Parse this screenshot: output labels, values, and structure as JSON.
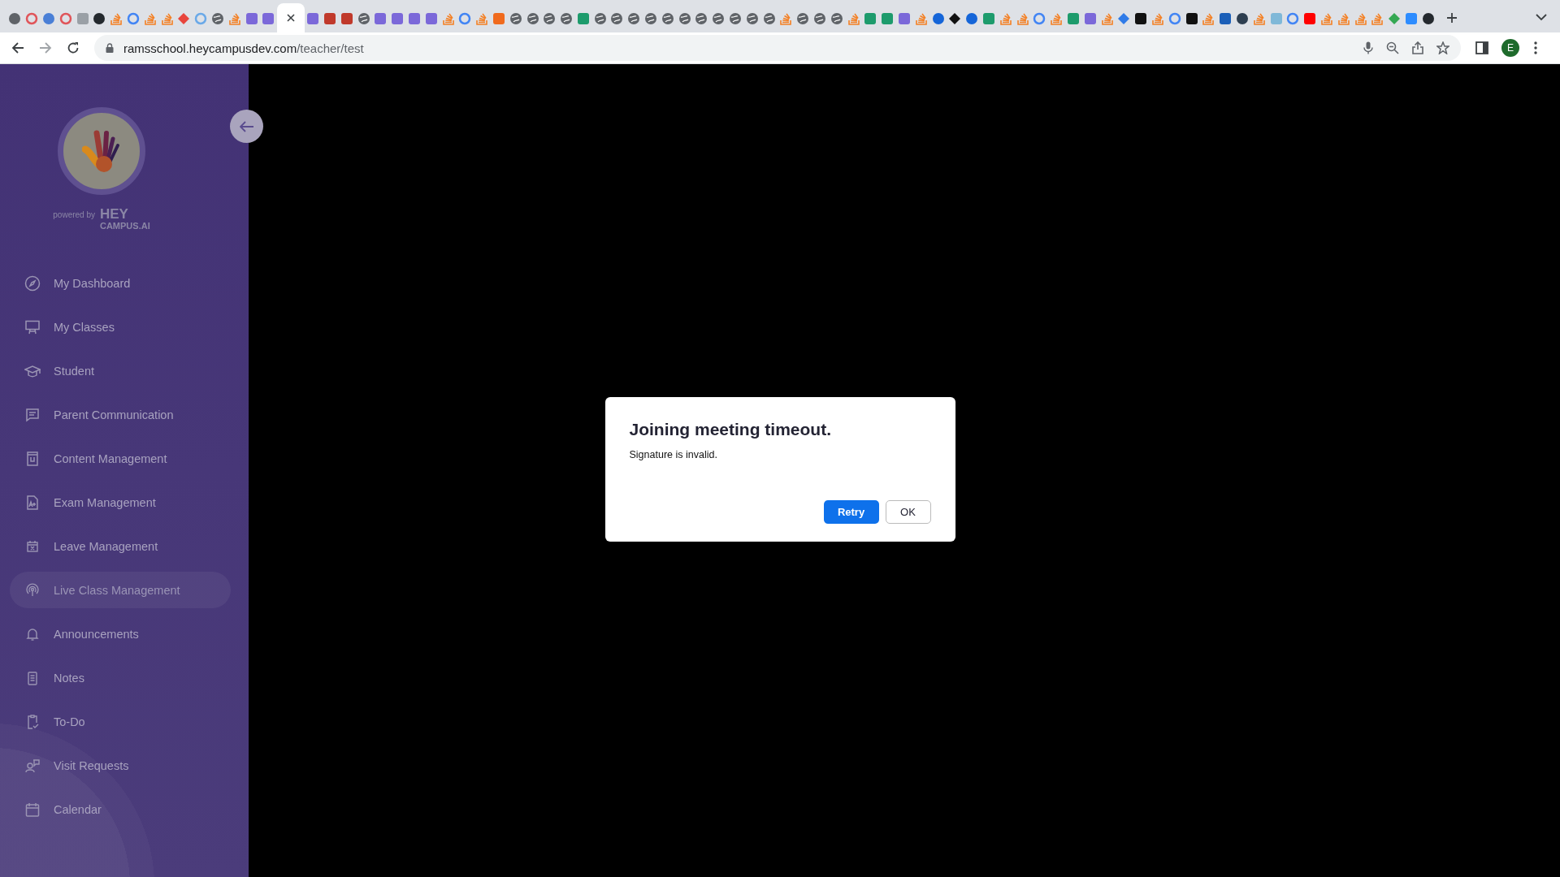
{
  "browser": {
    "tabs": [
      {
        "kind": "chrome",
        "selected": false
      },
      {
        "kind": "bug",
        "selected": false
      },
      {
        "kind": "cube",
        "selected": false
      },
      {
        "kind": "bug",
        "selected": false
      },
      {
        "kind": "star",
        "selected": false
      },
      {
        "kind": "github",
        "selected": false
      },
      {
        "kind": "stack",
        "selected": false
      },
      {
        "kind": "g",
        "selected": false
      },
      {
        "kind": "stack",
        "selected": false
      },
      {
        "kind": "stack",
        "selected": false
      },
      {
        "kind": "layers",
        "selected": false
      },
      {
        "kind": "cloud",
        "selected": false
      },
      {
        "kind": "globe",
        "selected": false
      },
      {
        "kind": "stack",
        "selected": false
      },
      {
        "kind": "h",
        "selected": false
      },
      {
        "kind": "h",
        "selected": false
      },
      {
        "selected": true
      },
      {
        "kind": "h",
        "selected": false
      },
      {
        "kind": "ghost",
        "selected": false
      },
      {
        "kind": "ghost",
        "selected": false
      },
      {
        "kind": "globe",
        "selected": false
      },
      {
        "kind": "h",
        "selected": false
      },
      {
        "kind": "h",
        "selected": false
      },
      {
        "kind": "h",
        "selected": false
      },
      {
        "kind": "h",
        "selected": false
      },
      {
        "kind": "stack",
        "selected": false
      },
      {
        "kind": "g",
        "selected": false
      },
      {
        "kind": "stack",
        "selected": false
      },
      {
        "kind": "f",
        "selected": false
      },
      {
        "kind": "globe",
        "selected": false
      },
      {
        "kind": "globe",
        "selected": false
      },
      {
        "kind": "globe",
        "selected": false
      },
      {
        "kind": "globe",
        "selected": false
      },
      {
        "kind": "w",
        "selected": false
      },
      {
        "kind": "globe",
        "selected": false
      },
      {
        "kind": "globe",
        "selected": false
      },
      {
        "kind": "globe",
        "selected": false
      },
      {
        "kind": "globe",
        "selected": false
      },
      {
        "kind": "globe",
        "selected": false
      },
      {
        "kind": "globe",
        "selected": false
      },
      {
        "kind": "globe",
        "selected": false
      },
      {
        "kind": "globe",
        "selected": false
      },
      {
        "kind": "globe",
        "selected": false
      },
      {
        "kind": "globe",
        "selected": false
      },
      {
        "kind": "globe",
        "selected": false
      },
      {
        "kind": "stack",
        "selected": false
      },
      {
        "kind": "globe",
        "selected": false
      },
      {
        "kind": "globe",
        "selected": false
      },
      {
        "kind": "globe",
        "selected": false
      },
      {
        "kind": "stack",
        "selected": false
      },
      {
        "kind": "w",
        "selected": false
      },
      {
        "kind": "w",
        "selected": false
      },
      {
        "kind": "h",
        "selected": false
      },
      {
        "kind": "stack",
        "selected": false
      },
      {
        "kind": "c",
        "selected": false
      },
      {
        "kind": "codepen",
        "selected": false
      },
      {
        "kind": "c",
        "selected": false
      },
      {
        "kind": "w",
        "selected": false
      },
      {
        "kind": "stack",
        "selected": false
      },
      {
        "kind": "stack",
        "selected": false
      },
      {
        "kind": "g",
        "selected": false
      },
      {
        "kind": "stack",
        "selected": false
      },
      {
        "kind": "w",
        "selected": false
      },
      {
        "kind": "h",
        "selected": false
      },
      {
        "kind": "stack",
        "selected": false
      },
      {
        "kind": "arrow",
        "selected": false
      },
      {
        "kind": "m",
        "selected": false
      },
      {
        "kind": "stack",
        "selected": false
      },
      {
        "kind": "g",
        "selected": false
      },
      {
        "kind": "m",
        "selected": false
      },
      {
        "kind": "stack",
        "selected": false
      },
      {
        "kind": "im",
        "selected": false
      },
      {
        "kind": "circle",
        "selected": false
      },
      {
        "kind": "stack",
        "selected": false
      },
      {
        "kind": "ib",
        "selected": false
      },
      {
        "kind": "g",
        "selected": false
      },
      {
        "kind": "youtube",
        "selected": false
      },
      {
        "kind": "stack",
        "selected": false
      },
      {
        "kind": "stack",
        "selected": false
      },
      {
        "kind": "stack",
        "selected": false
      },
      {
        "kind": "stack",
        "selected": false
      },
      {
        "kind": "maps",
        "selected": false
      },
      {
        "kind": "z",
        "selected": false
      },
      {
        "kind": "github",
        "selected": false
      }
    ],
    "address": {
      "host": "ramsschool.heycampusdev.com",
      "path": "/teacher/test"
    },
    "profile_initial": "E"
  },
  "sidebar": {
    "powered_by": "powered by",
    "brand_top": "HEY",
    "brand_bottom": "CAMPUS.AI",
    "items": [
      {
        "label": "My Dashboard",
        "kind": "dashboard",
        "selected": false
      },
      {
        "label": "My Classes",
        "kind": "board",
        "selected": false
      },
      {
        "label": "Student",
        "kind": "cap",
        "selected": false
      },
      {
        "label": "Parent Communication",
        "kind": "chat",
        "selected": false
      },
      {
        "label": "Content Management",
        "kind": "book",
        "selected": false
      },
      {
        "label": "Exam Management",
        "kind": "exam",
        "selected": false
      },
      {
        "label": "Leave Management",
        "kind": "leave",
        "selected": false
      },
      {
        "label": "Live Class Management",
        "kind": "live",
        "selected": true
      },
      {
        "label": "Announcements",
        "kind": "bell",
        "selected": false
      },
      {
        "label": "Notes",
        "kind": "notes",
        "selected": false
      },
      {
        "label": "To-Do",
        "kind": "todo",
        "selected": false
      },
      {
        "label": "Visit Requests",
        "kind": "visit",
        "selected": false
      },
      {
        "label": "Calendar",
        "kind": "calendar",
        "selected": false
      }
    ]
  },
  "dialog": {
    "title": "Joining meeting timeout.",
    "message": "Signature is invalid.",
    "buttons": [
      {
        "label": "Retry",
        "kind": "primary"
      },
      {
        "label": "OK",
        "kind": "secondary"
      }
    ]
  }
}
